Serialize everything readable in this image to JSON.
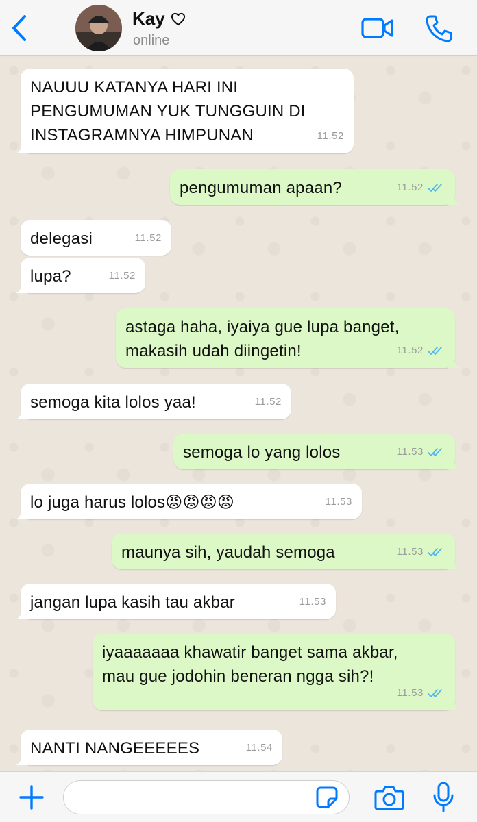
{
  "header": {
    "contact_name": "Kay",
    "status": "online",
    "icons": [
      "chevron-left-icon",
      "heart-outline-icon",
      "video-call-icon",
      "phone-icon"
    ],
    "accent_color": "#007aff"
  },
  "messages": [
    {
      "dir": "in",
      "text": "NAUUU KATANYA HARI INI\nPENGUMUMAN YUK TUNGGUIN DI\nINSTAGRAMNYA HIMPUNAN",
      "time": "11.52"
    },
    {
      "dir": "out",
      "text": "pengumuman apaan?",
      "time": "11.52"
    },
    {
      "dir": "in",
      "text": "delegasi",
      "time": "11.52"
    },
    {
      "dir": "in",
      "text": "lupa?",
      "time": "11.52"
    },
    {
      "dir": "out",
      "text": "astaga haha, iyaiya gue lupa banget,\nmakasih udah diingetin!",
      "time": "11.52"
    },
    {
      "dir": "in",
      "text": "semoga kita lolos yaa!",
      "time": "11.52"
    },
    {
      "dir": "out",
      "text": "semoga lo yang lolos",
      "time": "11.53"
    },
    {
      "dir": "in",
      "text": "lo juga harus lolos😡😡😡😡",
      "time": "11.53"
    },
    {
      "dir": "out",
      "text": "maunya sih, yaudah semoga",
      "time": "11.53"
    },
    {
      "dir": "in",
      "text": "jangan lupa kasih tau akbar",
      "time": "11.53"
    },
    {
      "dir": "out",
      "text": "iyaaaaaaa khawatir banget sama akbar,\nmau gue jodohin beneran ngga sih?!",
      "time": "11.53"
    },
    {
      "dir": "in",
      "text": "NANTI NANGEEEEES",
      "time": "11.54"
    }
  ],
  "colors": {
    "incoming_bubble": "#ffffff",
    "outgoing_bubble": "#dcf8c6",
    "read_ticks": "#4fb5f0",
    "chat_background": "#ece5dc"
  },
  "input_bar": {
    "placeholder": "",
    "icons": [
      "plus-icon",
      "sticker-icon",
      "camera-icon",
      "microphone-icon"
    ]
  }
}
